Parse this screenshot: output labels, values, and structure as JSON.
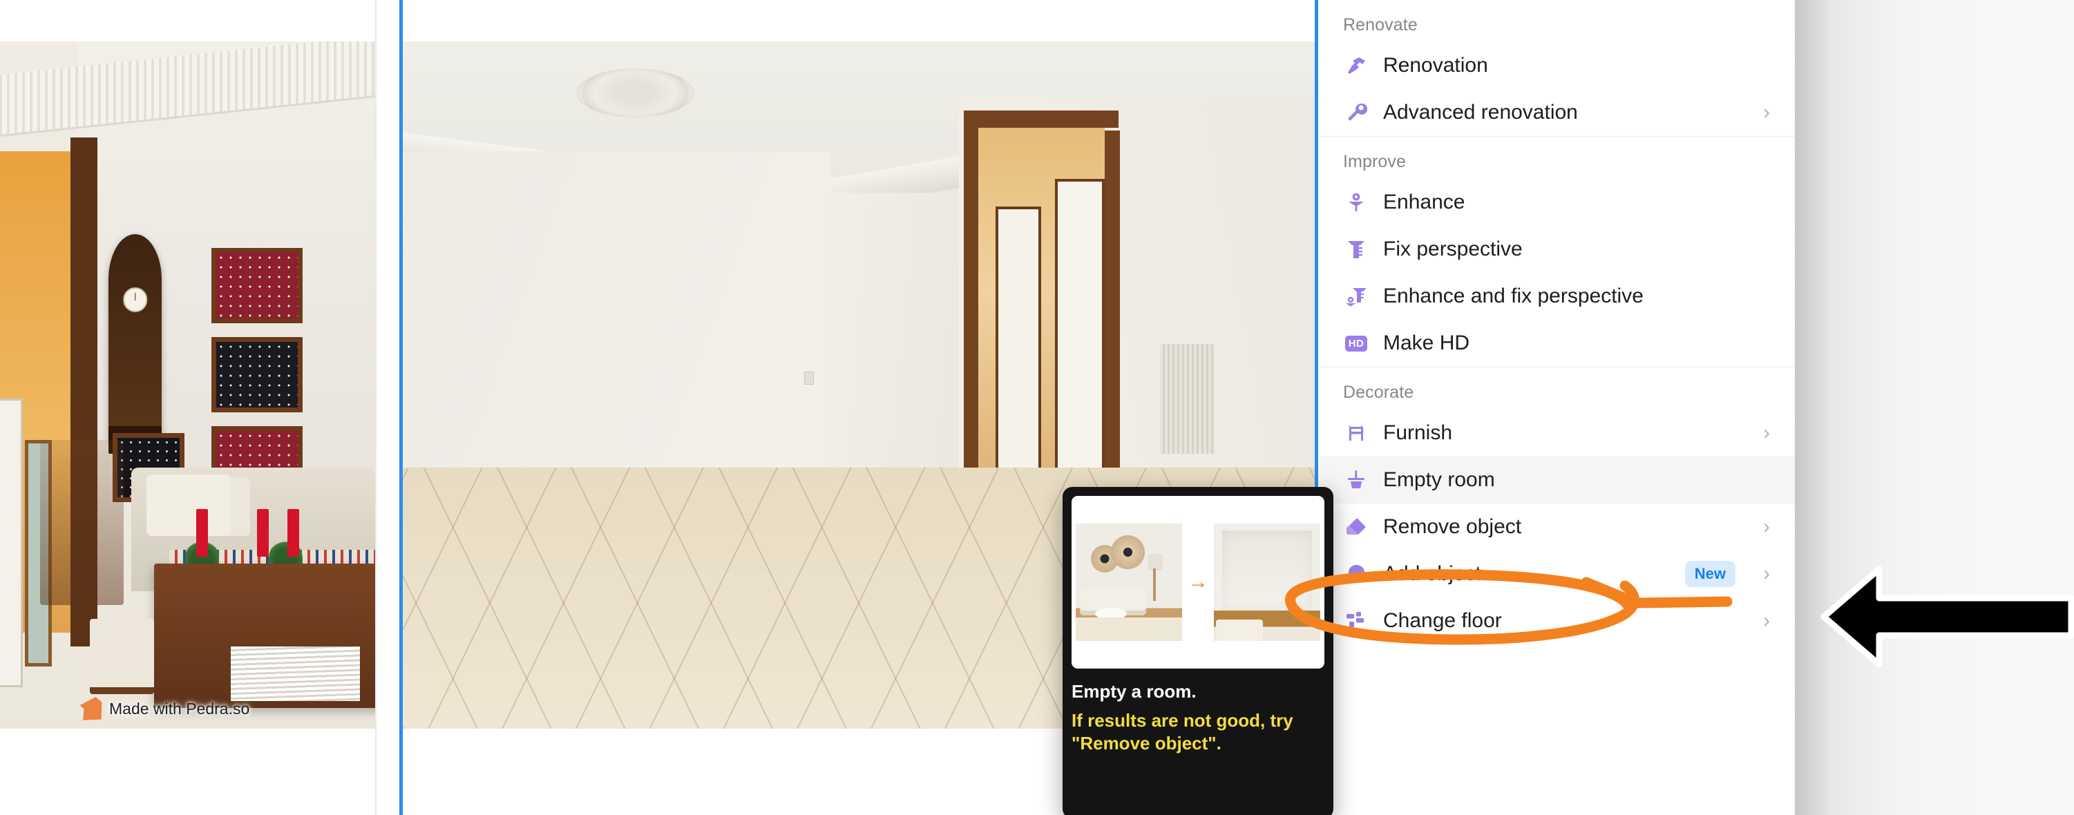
{
  "watermark": {
    "text": "Made with Pedra.so",
    "logo_icon": "pedra-logo-icon"
  },
  "tooltip": {
    "title": "Empty a room.",
    "note": "If results are not good, try \"Remove object\".",
    "arrow_icon": "arrow-right-icon",
    "before_label": "before-room-thumbnail",
    "after_label": "after-room-thumbnail"
  },
  "menu": {
    "sections": [
      {
        "title": "Renovate",
        "items": [
          {
            "label": "Renovation",
            "icon": "hammer-icon",
            "chevron": false,
            "badge": null,
            "highlight": false
          },
          {
            "label": "Advanced renovation",
            "icon": "wrench-icon",
            "chevron": true,
            "badge": null,
            "highlight": false
          }
        ]
      },
      {
        "title": "Improve",
        "items": [
          {
            "label": "Enhance",
            "icon": "flower-icon",
            "chevron": false,
            "badge": null,
            "highlight": false
          },
          {
            "label": "Fix perspective",
            "icon": "ruler-icon",
            "chevron": false,
            "badge": null,
            "highlight": false
          },
          {
            "label": "Enhance and fix perspective",
            "icon": "flower-ruler-icon",
            "chevron": false,
            "badge": null,
            "highlight": false
          },
          {
            "label": "Make HD",
            "icon": "hd-badge-icon",
            "chevron": false,
            "badge": null,
            "highlight": false,
            "icon_text": "HD"
          }
        ]
      },
      {
        "title": "Decorate",
        "items": [
          {
            "label": "Furnish",
            "icon": "chair-icon",
            "chevron": true,
            "badge": null,
            "highlight": false
          },
          {
            "label": "Empty room",
            "icon": "broom-icon",
            "chevron": false,
            "badge": null,
            "highlight": true
          },
          {
            "label": "Remove object",
            "icon": "eraser-icon",
            "chevron": true,
            "badge": null,
            "highlight": false
          },
          {
            "label": "Add object",
            "icon": "blob-icon",
            "chevron": true,
            "badge": "New",
            "highlight": false
          },
          {
            "label": "Change floor",
            "icon": "tiles-icon",
            "chevron": true,
            "badge": null,
            "highlight": false
          }
        ]
      }
    ]
  },
  "annotations": {
    "circle_color": "#F4811F",
    "arrow_color": "#000000",
    "target_label": "Empty room"
  },
  "colors": {
    "accent_purple": "#9b7ee8",
    "selection_blue": "#2d8cf0",
    "badge_blue_text": "#1a7ef0",
    "badge_blue_bg": "#d8ebfd",
    "tooltip_bg": "#141414",
    "tooltip_note": "#f2dd3f"
  }
}
